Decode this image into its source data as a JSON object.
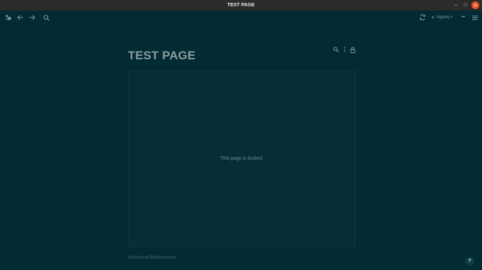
{
  "window": {
    "title": "TEST PAGE",
    "controls": {
      "minimize": "–",
      "maximize": "□",
      "close": "✕"
    }
  },
  "toolbar": {
    "repo_label": "logseq",
    "repo_plus": "+",
    "repo_caret": "▾",
    "more": "•••"
  },
  "page": {
    "title": "TEST PAGE",
    "locked_message": "This page is locked.",
    "unlinked_references": "Unlinked References"
  },
  "help": {
    "label": "?"
  },
  "colors": {
    "background": "#022b33",
    "panel": "#052e39",
    "close_button": "#e95420"
  }
}
